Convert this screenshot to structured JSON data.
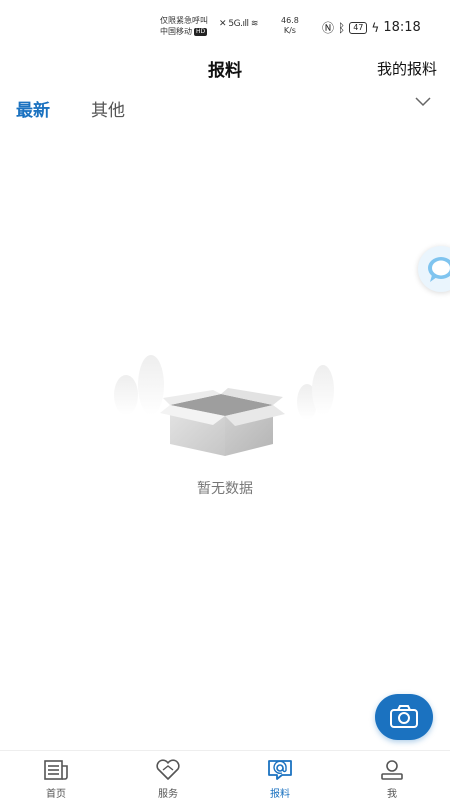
{
  "status_bar": {
    "carrier_line1": "仅限紧急呼叫",
    "carrier_line2": "中国移动",
    "hd_badge": "HD",
    "network": "⁵ᴳ.ıll",
    "speed_value": "46.8",
    "speed_unit": "K/s",
    "battery": "47",
    "time": "18:18"
  },
  "header": {
    "title": "报料",
    "my_reports": "我的报料"
  },
  "tabs": [
    {
      "label": "最新",
      "active": true
    },
    {
      "label": "其他",
      "active": false
    }
  ],
  "empty_state": {
    "text": "暂无数据"
  },
  "bottom_nav": [
    {
      "label": "首页",
      "icon": "news-icon",
      "active": false
    },
    {
      "label": "服务",
      "icon": "heart-icon",
      "active": false
    },
    {
      "label": "报料",
      "icon": "report-chat-icon",
      "active": true
    },
    {
      "label": "我",
      "icon": "user-icon",
      "active": false
    }
  ],
  "colors": {
    "accent": "#1b72c0",
    "text_muted": "#777777"
  }
}
